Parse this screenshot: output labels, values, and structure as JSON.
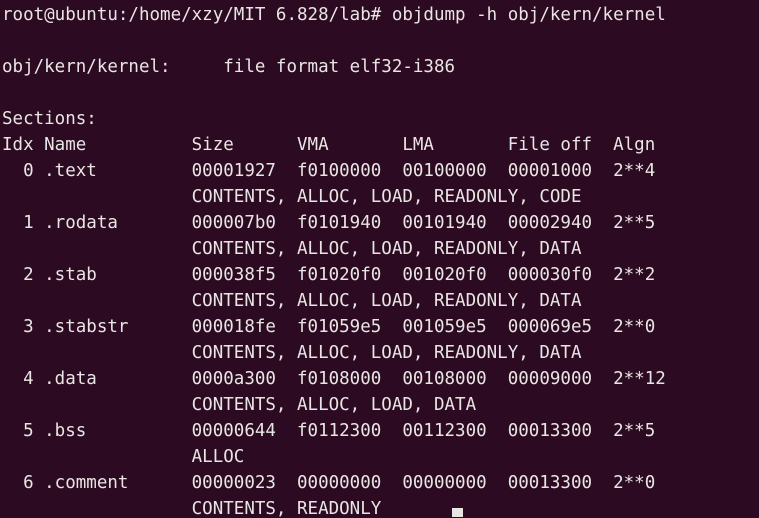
{
  "terminal": {
    "colors": {
      "background": "#2b0a22",
      "foreground": "#e9e5e3",
      "cursor": "#e9e5e3"
    },
    "prompt_line": "root@ubuntu:/home/xzy/MIT 6.828/lab# objdump -h obj/kern/kernel",
    "prompt": {
      "user": "root",
      "host": "ubuntu",
      "cwd": "/home/xzy/MIT 6.828/lab",
      "symbol": "#",
      "command": "objdump -h obj/kern/kernel"
    },
    "blank_line": "",
    "file_format_line": "obj/kern/kernel:     file format elf32-i386",
    "file_format": {
      "file": "obj/kern/kernel:",
      "description": "file format elf32-i386"
    },
    "sections_label": "Sections:",
    "header_line": "Idx Name          Size      VMA       LMA       File off  Algn",
    "headers": {
      "idx": "Idx",
      "name": "Name",
      "size": "Size",
      "vma": "VMA",
      "lma": "LMA",
      "file_off": "File off",
      "algn": "Algn"
    },
    "rows": [
      {
        "entry_line": "  0 .text         00001927  f0100000  00100000  00001000  2**4",
        "idx": "0",
        "name": ".text",
        "size": "00001927",
        "vma": "f0100000",
        "lma": "00100000",
        "file_off": "00001000",
        "algn": "2**4",
        "flags_line": "                  CONTENTS, ALLOC, LOAD, READONLY, CODE",
        "flags": "CONTENTS, ALLOC, LOAD, READONLY, CODE"
      },
      {
        "entry_line": "  1 .rodata       000007b0  f0101940  00101940  00002940  2**5",
        "idx": "1",
        "name": ".rodata",
        "size": "000007b0",
        "vma": "f0101940",
        "lma": "00101940",
        "file_off": "00002940",
        "algn": "2**5",
        "flags_line": "                  CONTENTS, ALLOC, LOAD, READONLY, DATA",
        "flags": "CONTENTS, ALLOC, LOAD, READONLY, DATA"
      },
      {
        "entry_line": "  2 .stab         000038f5  f01020f0  001020f0  000030f0  2**2",
        "idx": "2",
        "name": ".stab",
        "size": "000038f5",
        "vma": "f01020f0",
        "lma": "001020f0",
        "file_off": "000030f0",
        "algn": "2**2",
        "flags_line": "                  CONTENTS, ALLOC, LOAD, READONLY, DATA",
        "flags": "CONTENTS, ALLOC, LOAD, READONLY, DATA"
      },
      {
        "entry_line": "  3 .stabstr      000018fe  f01059e5  001059e5  000069e5  2**0",
        "idx": "3",
        "name": ".stabstr",
        "size": "000018fe",
        "vma": "f01059e5",
        "lma": "001059e5",
        "file_off": "000069e5",
        "algn": "2**0",
        "flags_line": "                  CONTENTS, ALLOC, LOAD, READONLY, DATA",
        "flags": "CONTENTS, ALLOC, LOAD, READONLY, DATA"
      },
      {
        "entry_line": "  4 .data         0000a300  f0108000  00108000  00009000  2**12",
        "idx": "4",
        "name": ".data",
        "size": "0000a300",
        "vma": "f0108000",
        "lma": "00108000",
        "file_off": "00009000",
        "algn": "2**12",
        "flags_line": "                  CONTENTS, ALLOC, LOAD, DATA",
        "flags": "CONTENTS, ALLOC, LOAD, DATA"
      },
      {
        "entry_line": "  5 .bss          00000644  f0112300  00112300  00013300  2**5",
        "idx": "5",
        "name": ".bss",
        "size": "00000644",
        "vma": "f0112300",
        "lma": "00112300",
        "file_off": "00013300",
        "algn": "2**5",
        "flags_line": "                  ALLOC",
        "flags": "ALLOC"
      },
      {
        "entry_line": "  6 .comment      00000023  00000000  00000000  00013300  2**0",
        "idx": "6",
        "name": ".comment",
        "size": "00000023",
        "vma": "00000000",
        "lma": "00000000",
        "file_off": "00013300",
        "algn": "2**0",
        "flags_line": "                  CONTENTS, READONLY",
        "flags": "CONTENTS, READONLY"
      }
    ]
  }
}
